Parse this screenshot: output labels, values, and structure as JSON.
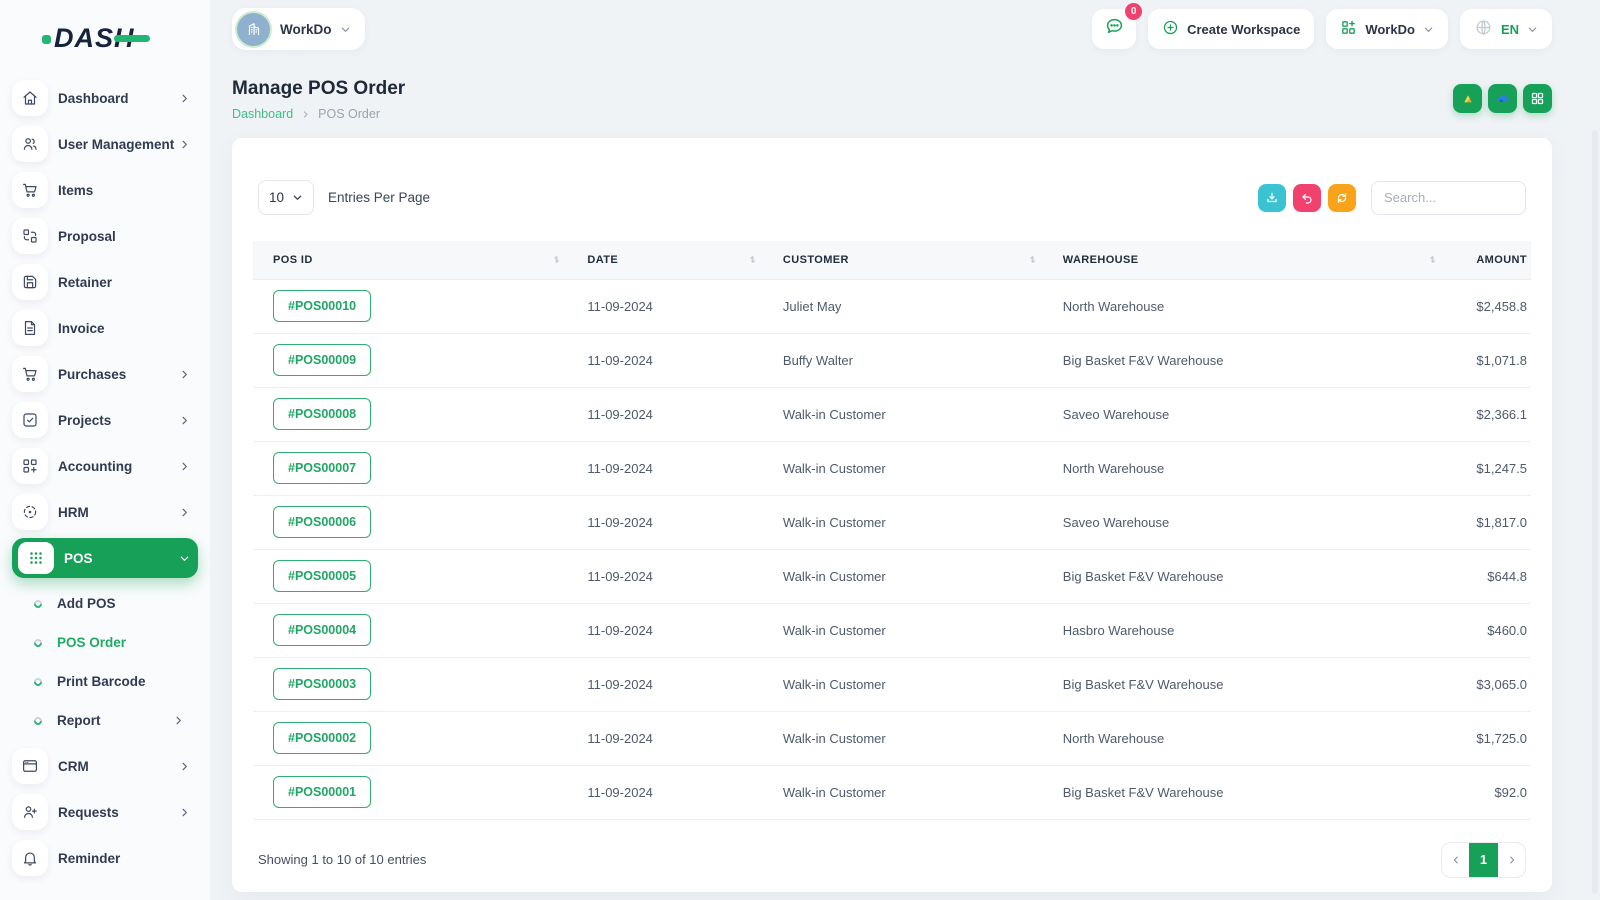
{
  "app": {
    "logo_text": "DASH"
  },
  "topbar": {
    "workspace_name": "WorkDo",
    "messages_badge": "0",
    "create_workspace_label": "Create Workspace",
    "workspace_menu_label": "WorkDo",
    "language_label": "EN"
  },
  "sidebar": {
    "items_top": [
      {
        "label": "Dashboard",
        "icon": "home",
        "chevron": true
      },
      {
        "label": "User Management",
        "icon": "users",
        "chevron": true
      },
      {
        "label": "Items",
        "icon": "cart",
        "chevron": false
      },
      {
        "label": "Proposal",
        "icon": "proposal",
        "chevron": false
      },
      {
        "label": "Retainer",
        "icon": "retainer",
        "chevron": false
      },
      {
        "label": "Invoice",
        "icon": "invoice",
        "chevron": false
      },
      {
        "label": "Purchases",
        "icon": "cart",
        "chevron": true
      },
      {
        "label": "Projects",
        "icon": "projects",
        "chevron": true
      },
      {
        "label": "Accounting",
        "icon": "accounting",
        "chevron": true
      },
      {
        "label": "HRM",
        "icon": "hrm",
        "chevron": true
      }
    ],
    "pos": {
      "label": "POS",
      "icon": "pos"
    },
    "pos_submenu": [
      {
        "label": "Add POS",
        "active": false,
        "chevron": false
      },
      {
        "label": "POS Order",
        "active": true,
        "chevron": false
      },
      {
        "label": "Print Barcode",
        "active": false,
        "chevron": false
      },
      {
        "label": "Report",
        "active": false,
        "chevron": true
      }
    ],
    "items_bottom": [
      {
        "label": "CRM",
        "icon": "crm",
        "chevron": true
      },
      {
        "label": "Requests",
        "icon": "requests",
        "chevron": true
      },
      {
        "label": "Reminder",
        "icon": "bell",
        "chevron": false
      }
    ]
  },
  "page": {
    "title": "Manage POS Order",
    "breadcrumb_link": "Dashboard",
    "breadcrumb_current": "POS Order"
  },
  "controls": {
    "entries_value": "10",
    "entries_label": "Entries Per Page",
    "search_placeholder": "Search..."
  },
  "table": {
    "columns": [
      "POS ID",
      "DATE",
      "CUSTOMER",
      "WAREHOUSE",
      "AMOUNT"
    ],
    "rows": [
      {
        "pos_id": "#POS00010",
        "date": "11-09-2024",
        "customer": "Juliet May",
        "warehouse": "North Warehouse",
        "amount": "$2,458.8"
      },
      {
        "pos_id": "#POS00009",
        "date": "11-09-2024",
        "customer": "Buffy Walter",
        "warehouse": "Big Basket F&V Warehouse",
        "amount": "$1,071.8"
      },
      {
        "pos_id": "#POS00008",
        "date": "11-09-2024",
        "customer": "Walk-in Customer",
        "warehouse": "Saveo Warehouse",
        "amount": "$2,366.1"
      },
      {
        "pos_id": "#POS00007",
        "date": "11-09-2024",
        "customer": "Walk-in Customer",
        "warehouse": "North Warehouse",
        "amount": "$1,247.5"
      },
      {
        "pos_id": "#POS00006",
        "date": "11-09-2024",
        "customer": "Walk-in Customer",
        "warehouse": "Saveo Warehouse",
        "amount": "$1,817.0"
      },
      {
        "pos_id": "#POS00005",
        "date": "11-09-2024",
        "customer": "Walk-in Customer",
        "warehouse": "Big Basket F&V Warehouse",
        "amount": "$644.8"
      },
      {
        "pos_id": "#POS00004",
        "date": "11-09-2024",
        "customer": "Walk-in Customer",
        "warehouse": "Hasbro Warehouse",
        "amount": "$460.0"
      },
      {
        "pos_id": "#POS00003",
        "date": "11-09-2024",
        "customer": "Walk-in Customer",
        "warehouse": "Big Basket F&V Warehouse",
        "amount": "$3,065.0"
      },
      {
        "pos_id": "#POS00002",
        "date": "11-09-2024",
        "customer": "Walk-in Customer",
        "warehouse": "North Warehouse",
        "amount": "$1,725.0"
      },
      {
        "pos_id": "#POS00001",
        "date": "11-09-2024",
        "customer": "Walk-in Customer",
        "warehouse": "Big Basket F&V Warehouse",
        "amount": "$92.0"
      }
    ]
  },
  "footer": {
    "showing_text": "Showing 1 to 10 of 10 entries",
    "current_page": "1"
  },
  "colors": {
    "accent_green": "#17a158",
    "breadcrumb_green": "#3fbf83",
    "download_teal": "#3cc3d2",
    "undo_pink": "#f1416c",
    "refresh_orange": "#f9a31b",
    "badge_red": "#f2416c"
  }
}
